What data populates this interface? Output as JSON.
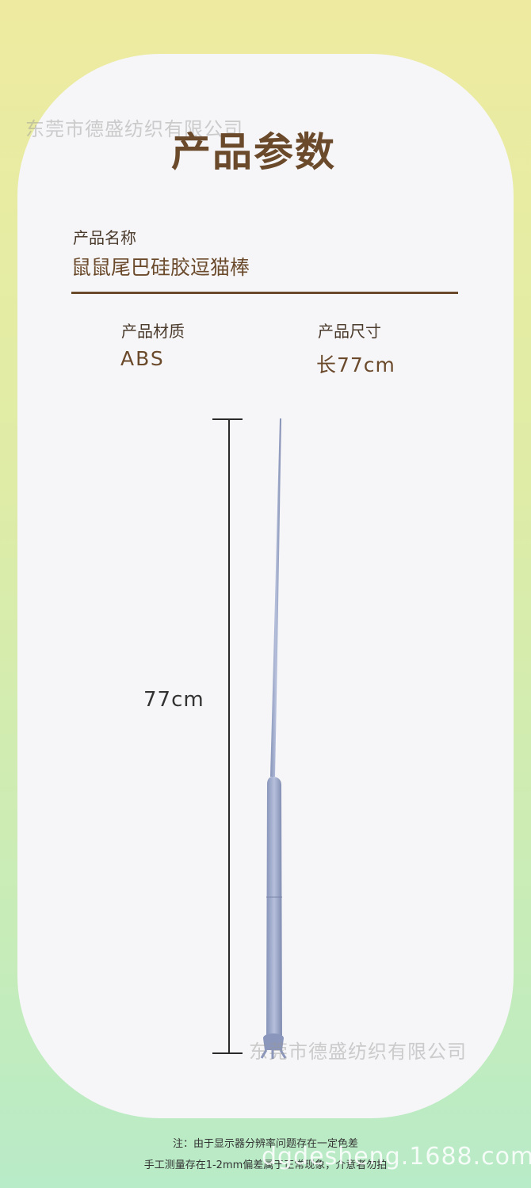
{
  "header": {
    "title": "产品参数"
  },
  "params": {
    "name_label": "产品名称",
    "name_value": "鼠鼠尾巴硅胶逗猫棒",
    "material_label": "产品材质",
    "material_value": "ABS",
    "size_label": "产品尺寸",
    "size_value": "长77cm"
  },
  "dimension": {
    "length_label": "77cm"
  },
  "notes": {
    "line1": "注：由于显示器分辨率问题存在一定色差",
    "line2": "手工测量存在1-2mm偏差属于正常现象，介意者勿拍"
  },
  "watermarks": {
    "company": "东莞市德盛纺织有限公司",
    "site": "dgdesheng.1688.com"
  },
  "colors": {
    "title": "#6b4a2c",
    "card": "#f6f6f8",
    "product": "#9aa6c8"
  }
}
